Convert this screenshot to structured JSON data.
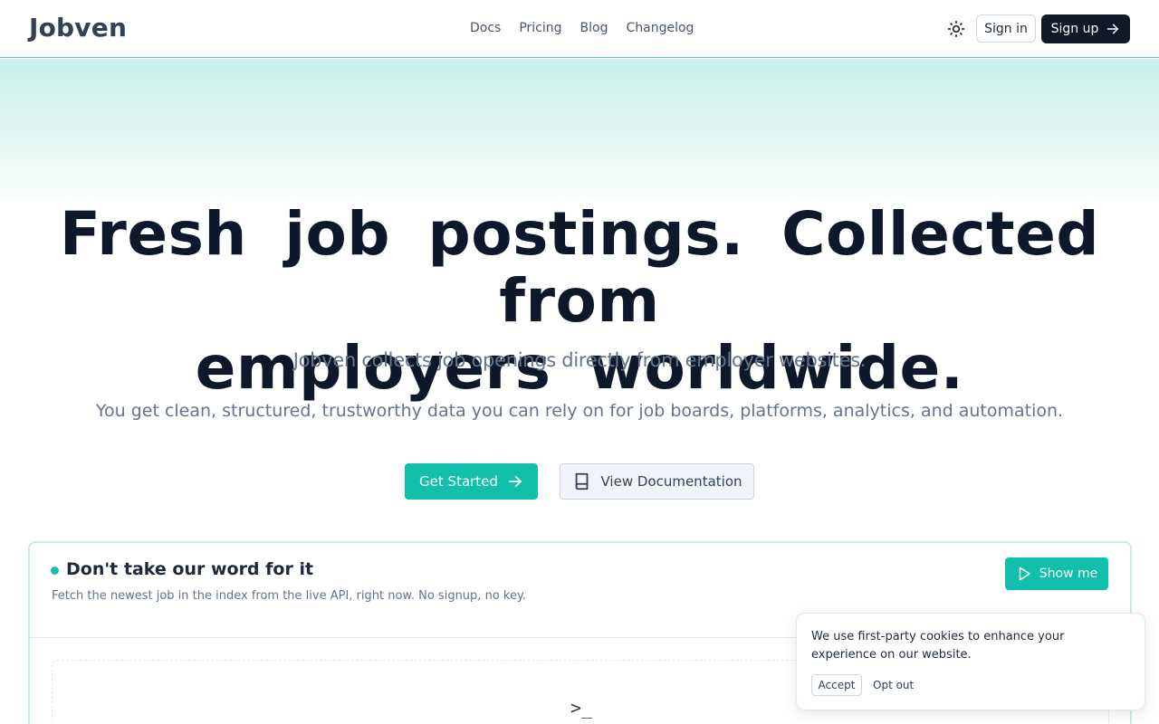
{
  "header": {
    "logo": "Jobven",
    "nav": [
      "Docs",
      "Pricing",
      "Blog",
      "Changelog"
    ],
    "theme_icon": "sun-icon",
    "sign_in": "Sign in",
    "sign_up": "Sign up"
  },
  "hero": {
    "title_line1": "Fresh job postings. Collected from",
    "title_line2": "employers worldwide.",
    "subtitle": "Jobven collects job openings directly from employer websites.",
    "description": "You get clean, structured, trustworthy data you can rely on for job boards, platforms, analytics, and automation.",
    "primary_cta": "Get Started",
    "secondary_cta": "View Documentation"
  },
  "demo": {
    "title": "Don't take our word for it",
    "description": "Fetch the newest job in the index from the live API, right now. No signup, no key.",
    "button": "Show me",
    "terminal_glyph": ">_"
  },
  "cookie": {
    "text": "We use first-party cookies to enhance your experience on our website.",
    "accept": "Accept",
    "opt_out": "Opt out"
  },
  "colors": {
    "accent": "#10c0ab",
    "dark": "#111827",
    "text_muted": "#64748b"
  }
}
